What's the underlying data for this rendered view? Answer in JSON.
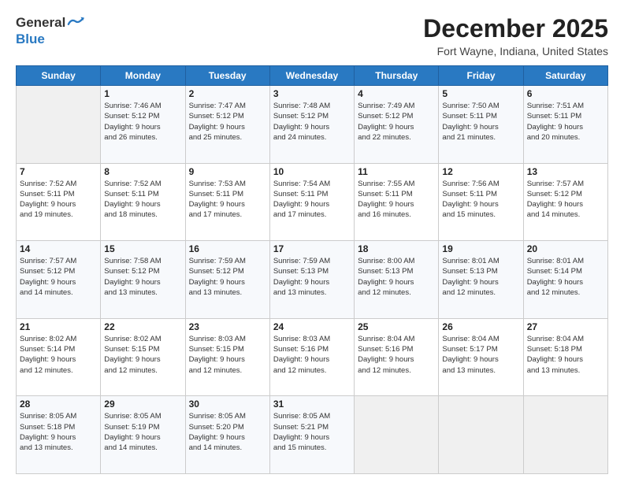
{
  "header": {
    "logo_general": "General",
    "logo_blue": "Blue",
    "title": "December 2025",
    "subtitle": "Fort Wayne, Indiana, United States"
  },
  "days_of_week": [
    "Sunday",
    "Monday",
    "Tuesday",
    "Wednesday",
    "Thursday",
    "Friday",
    "Saturday"
  ],
  "weeks": [
    [
      {
        "day": "",
        "info": ""
      },
      {
        "day": "1",
        "info": "Sunrise: 7:46 AM\nSunset: 5:12 PM\nDaylight: 9 hours\nand 26 minutes."
      },
      {
        "day": "2",
        "info": "Sunrise: 7:47 AM\nSunset: 5:12 PM\nDaylight: 9 hours\nand 25 minutes."
      },
      {
        "day": "3",
        "info": "Sunrise: 7:48 AM\nSunset: 5:12 PM\nDaylight: 9 hours\nand 24 minutes."
      },
      {
        "day": "4",
        "info": "Sunrise: 7:49 AM\nSunset: 5:12 PM\nDaylight: 9 hours\nand 22 minutes."
      },
      {
        "day": "5",
        "info": "Sunrise: 7:50 AM\nSunset: 5:11 PM\nDaylight: 9 hours\nand 21 minutes."
      },
      {
        "day": "6",
        "info": "Sunrise: 7:51 AM\nSunset: 5:11 PM\nDaylight: 9 hours\nand 20 minutes."
      }
    ],
    [
      {
        "day": "7",
        "info": "Sunrise: 7:52 AM\nSunset: 5:11 PM\nDaylight: 9 hours\nand 19 minutes."
      },
      {
        "day": "8",
        "info": "Sunrise: 7:52 AM\nSunset: 5:11 PM\nDaylight: 9 hours\nand 18 minutes."
      },
      {
        "day": "9",
        "info": "Sunrise: 7:53 AM\nSunset: 5:11 PM\nDaylight: 9 hours\nand 17 minutes."
      },
      {
        "day": "10",
        "info": "Sunrise: 7:54 AM\nSunset: 5:11 PM\nDaylight: 9 hours\nand 17 minutes."
      },
      {
        "day": "11",
        "info": "Sunrise: 7:55 AM\nSunset: 5:11 PM\nDaylight: 9 hours\nand 16 minutes."
      },
      {
        "day": "12",
        "info": "Sunrise: 7:56 AM\nSunset: 5:11 PM\nDaylight: 9 hours\nand 15 minutes."
      },
      {
        "day": "13",
        "info": "Sunrise: 7:57 AM\nSunset: 5:12 PM\nDaylight: 9 hours\nand 14 minutes."
      }
    ],
    [
      {
        "day": "14",
        "info": "Sunrise: 7:57 AM\nSunset: 5:12 PM\nDaylight: 9 hours\nand 14 minutes."
      },
      {
        "day": "15",
        "info": "Sunrise: 7:58 AM\nSunset: 5:12 PM\nDaylight: 9 hours\nand 13 minutes."
      },
      {
        "day": "16",
        "info": "Sunrise: 7:59 AM\nSunset: 5:12 PM\nDaylight: 9 hours\nand 13 minutes."
      },
      {
        "day": "17",
        "info": "Sunrise: 7:59 AM\nSunset: 5:13 PM\nDaylight: 9 hours\nand 13 minutes."
      },
      {
        "day": "18",
        "info": "Sunrise: 8:00 AM\nSunset: 5:13 PM\nDaylight: 9 hours\nand 12 minutes."
      },
      {
        "day": "19",
        "info": "Sunrise: 8:01 AM\nSunset: 5:13 PM\nDaylight: 9 hours\nand 12 minutes."
      },
      {
        "day": "20",
        "info": "Sunrise: 8:01 AM\nSunset: 5:14 PM\nDaylight: 9 hours\nand 12 minutes."
      }
    ],
    [
      {
        "day": "21",
        "info": "Sunrise: 8:02 AM\nSunset: 5:14 PM\nDaylight: 9 hours\nand 12 minutes."
      },
      {
        "day": "22",
        "info": "Sunrise: 8:02 AM\nSunset: 5:15 PM\nDaylight: 9 hours\nand 12 minutes."
      },
      {
        "day": "23",
        "info": "Sunrise: 8:03 AM\nSunset: 5:15 PM\nDaylight: 9 hours\nand 12 minutes."
      },
      {
        "day": "24",
        "info": "Sunrise: 8:03 AM\nSunset: 5:16 PM\nDaylight: 9 hours\nand 12 minutes."
      },
      {
        "day": "25",
        "info": "Sunrise: 8:04 AM\nSunset: 5:16 PM\nDaylight: 9 hours\nand 12 minutes."
      },
      {
        "day": "26",
        "info": "Sunrise: 8:04 AM\nSunset: 5:17 PM\nDaylight: 9 hours\nand 13 minutes."
      },
      {
        "day": "27",
        "info": "Sunrise: 8:04 AM\nSunset: 5:18 PM\nDaylight: 9 hours\nand 13 minutes."
      }
    ],
    [
      {
        "day": "28",
        "info": "Sunrise: 8:05 AM\nSunset: 5:18 PM\nDaylight: 9 hours\nand 13 minutes."
      },
      {
        "day": "29",
        "info": "Sunrise: 8:05 AM\nSunset: 5:19 PM\nDaylight: 9 hours\nand 14 minutes."
      },
      {
        "day": "30",
        "info": "Sunrise: 8:05 AM\nSunset: 5:20 PM\nDaylight: 9 hours\nand 14 minutes."
      },
      {
        "day": "31",
        "info": "Sunrise: 8:05 AM\nSunset: 5:21 PM\nDaylight: 9 hours\nand 15 minutes."
      },
      {
        "day": "",
        "info": ""
      },
      {
        "day": "",
        "info": ""
      },
      {
        "day": "",
        "info": ""
      }
    ]
  ]
}
